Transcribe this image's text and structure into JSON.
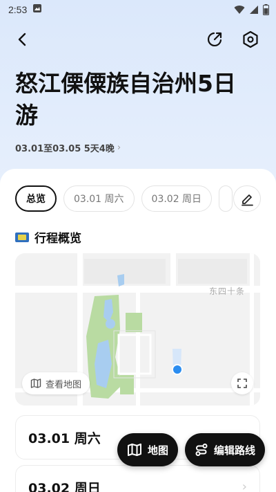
{
  "status_bar": {
    "time": "2:53"
  },
  "header": {
    "title": "怒江傈僳族自治州5日游",
    "subtitle": "03.01至03.05 5天4晚"
  },
  "tabs": [
    {
      "label": "总览",
      "active": true
    },
    {
      "label": "03.01 周六"
    },
    {
      "label": "03.02 周日"
    }
  ],
  "overview": {
    "title": "行程概览",
    "map": {
      "street_label": "东四十条",
      "view_map_label": "查看地图"
    }
  },
  "days": [
    {
      "label": "03.01 周六"
    },
    {
      "label": "03.02 周日"
    }
  ],
  "actions": {
    "map_label": "地图",
    "edit_route_label": "编辑路线"
  },
  "colors": {
    "accent": "#2b8df0",
    "park_green": "#b9dba2",
    "water_blue": "#a8cdf0",
    "dark_button": "#111111"
  }
}
